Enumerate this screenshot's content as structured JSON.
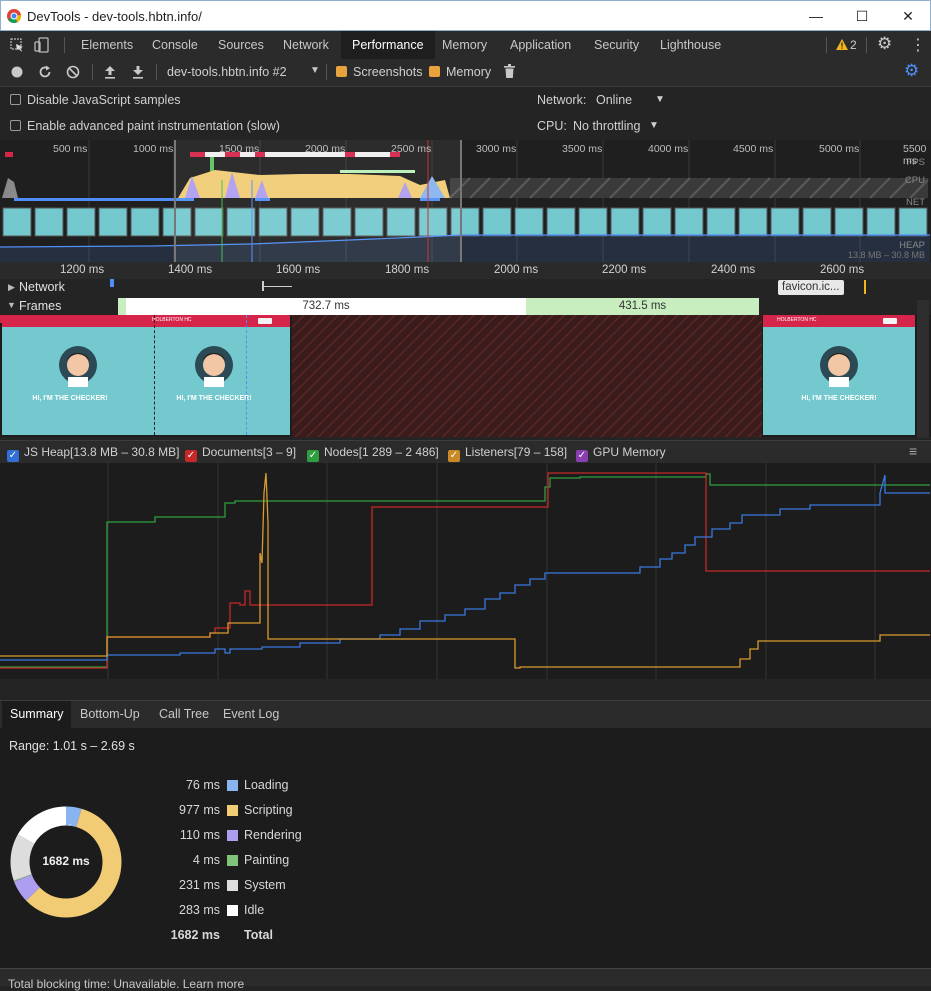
{
  "window": {
    "title": "DevTools - dev-tools.hbtn.info/"
  },
  "tabs": [
    "Elements",
    "Console",
    "Sources",
    "Network",
    "Performance",
    "Memory",
    "Application",
    "Security",
    "Lighthouse"
  ],
  "active_tab": "Performance",
  "warnings_count": "2",
  "toolbar": {
    "profile_select": "dev-tools.hbtn.info #2",
    "screenshots_label": "Screenshots",
    "memory_label": "Memory"
  },
  "settings": {
    "disable_js_label": "Disable JavaScript samples",
    "adv_paint_label": "Enable advanced paint instrumentation (slow)",
    "network_label": "Network:",
    "network_value": "Online",
    "cpu_label": "CPU:",
    "cpu_value": "No throttling"
  },
  "overview": {
    "ticks": [
      "500 ms",
      "1000 ms",
      "1500 ms",
      "2000 ms",
      "2500 ms",
      "3000 ms",
      "3500 ms",
      "4000 ms",
      "4500 ms",
      "5000 ms",
      "5500 ms"
    ],
    "labels": {
      "fps": "FPS",
      "cpu": "CPU",
      "net": "NET",
      "heap": "HEAP",
      "heap_range": "13.8 MB – 30.8 MB"
    }
  },
  "ruler": {
    "ticks": [
      "1200 ms",
      "1400 ms",
      "1600 ms",
      "1800 ms",
      "2000 ms",
      "2200 ms",
      "2400 ms",
      "2600 ms"
    ]
  },
  "tracks": {
    "network": "Network",
    "frames": "Frames",
    "frame1": "732.7 ms",
    "frame2": "431.5 ms",
    "favicon": "favicon.ic..."
  },
  "screenshot_text": {
    "site": "HOLBERTON HC",
    "headline": "HI, I'M THE CHECKER!"
  },
  "legend": [
    {
      "label": "JS Heap[13.8 MB – 30.8 MB]",
      "color": "#2f6fd6"
    },
    {
      "label": "Documents[3 – 9]",
      "color": "#c62828"
    },
    {
      "label": "Nodes[1 289 – 2 486]",
      "color": "#2e9e3e"
    },
    {
      "label": "Listeners[79 – 158]",
      "color": "#c98a25"
    },
    {
      "label": "GPU Memory",
      "color": "#8a3fb0"
    }
  ],
  "bottom_tabs": [
    "Summary",
    "Bottom-Up",
    "Call Tree",
    "Event Log"
  ],
  "summary": {
    "range": "Range: 1.01 s – 2.69 s",
    "total_center": "1682 ms",
    "rows": [
      {
        "value": "76 ms",
        "label": "Loading",
        "color": "#8ab4f0"
      },
      {
        "value": "977 ms",
        "label": "Scripting",
        "color": "#f2cc74"
      },
      {
        "value": "110 ms",
        "label": "Rendering",
        "color": "#af9ef0"
      },
      {
        "value": "4 ms",
        "label": "Painting",
        "color": "#7fc27a"
      },
      {
        "value": "231 ms",
        "label": "System",
        "color": "#dddddd"
      },
      {
        "value": "283 ms",
        "label": "Idle",
        "color": "#ffffff"
      }
    ],
    "total": {
      "value": "1682 ms",
      "label": "Total"
    }
  },
  "footer": "Total blocking time: Unavailable. Learn more"
}
